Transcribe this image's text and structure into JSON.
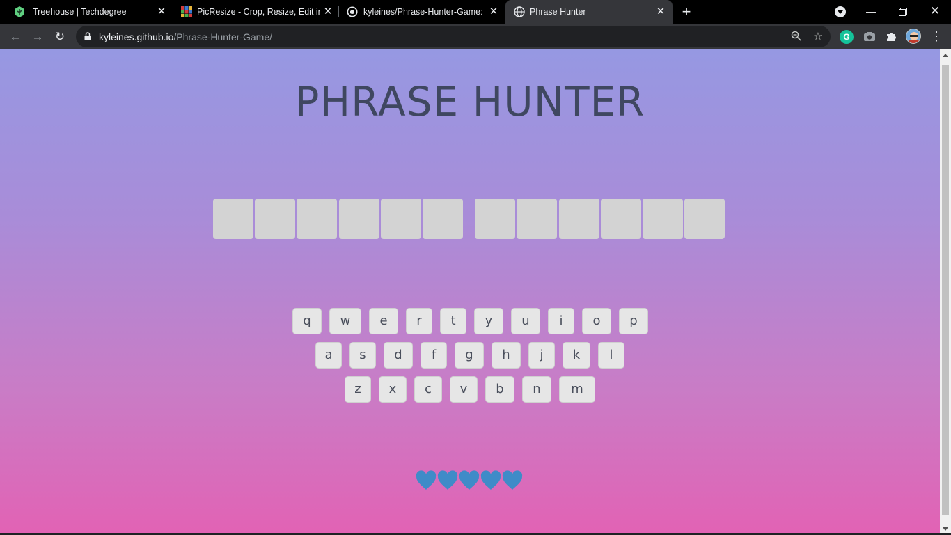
{
  "browser": {
    "tabs": [
      {
        "title": "Treehouse | Techdegree",
        "favicon": "treehouse-icon",
        "active": false
      },
      {
        "title": "PicResize - Crop, Resize, Edit ima",
        "favicon": "picresize-icon",
        "active": false
      },
      {
        "title": "kyleines/Phrase-Hunter-Game: Te",
        "favicon": "github-icon",
        "active": false
      },
      {
        "title": "Phrase Hunter",
        "favicon": "globe-icon",
        "active": true
      }
    ],
    "new_tab": "+",
    "address": {
      "host": "kyleines.github.io",
      "path": "/Phrase-Hunter-Game/"
    },
    "extensions": [
      "grammarly-icon",
      "camera-icon",
      "puzzle-icon",
      "avatar-icon"
    ],
    "grammarly_letter": "G"
  },
  "game": {
    "title": "PHRASE HUNTER",
    "phrase_words": [
      6,
      6
    ],
    "keyboard": [
      [
        "q",
        "w",
        "e",
        "r",
        "t",
        "y",
        "u",
        "i",
        "o",
        "p"
      ],
      [
        "a",
        "s",
        "d",
        "f",
        "g",
        "h",
        "j",
        "k",
        "l"
      ],
      [
        "z",
        "x",
        "c",
        "v",
        "b",
        "n",
        "m"
      ]
    ],
    "lives": 5,
    "heart_color": "#3f8bc8"
  }
}
